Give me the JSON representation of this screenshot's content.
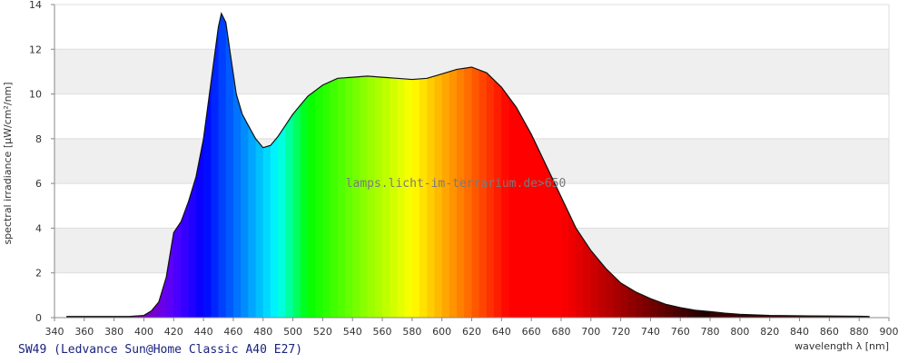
{
  "chart_data": {
    "type": "area",
    "title": "SW49 (Ledvance Sun@Home Classic A40 E27)",
    "xlabel": "wavelength λ [nm]",
    "ylabel": "spectral irradiance [µW/cm²/nm]",
    "watermark": "lamps.licht-im-terrarium.de>650",
    "xlim": [
      340,
      900
    ],
    "ylim": [
      0,
      14
    ],
    "x_ticks": [
      340,
      360,
      380,
      400,
      420,
      440,
      460,
      480,
      500,
      520,
      540,
      560,
      580,
      600,
      620,
      640,
      660,
      680,
      700,
      720,
      740,
      760,
      780,
      800,
      820,
      840,
      860,
      880,
      900
    ],
    "y_ticks": [
      0,
      2,
      4,
      6,
      8,
      10,
      12,
      14
    ],
    "grid": "horizontal alternating bands",
    "fill": "wavelength spectrum colors",
    "series": [
      {
        "x": [
          348,
          390,
          400,
          405,
          410,
          415,
          420,
          425,
          430,
          435,
          440,
          445,
          450,
          452,
          455,
          458,
          462,
          466,
          470,
          475,
          480,
          485,
          490,
          495,
          500,
          510,
          520,
          530,
          540,
          550,
          560,
          570,
          580,
          590,
          600,
          610,
          620,
          630,
          640,
          650,
          660,
          670,
          680,
          690,
          700,
          710,
          720,
          730,
          740,
          750,
          760,
          770,
          780,
          790,
          800,
          820,
          840,
          860,
          880,
          887
        ],
        "y": [
          0.05,
          0.05,
          0.1,
          0.3,
          0.7,
          1.8,
          3.8,
          4.3,
          5.2,
          6.3,
          8.0,
          10.5,
          13.0,
          13.6,
          13.2,
          11.8,
          10.0,
          9.1,
          8.6,
          8.0,
          7.6,
          7.7,
          8.1,
          8.6,
          9.1,
          9.9,
          10.4,
          10.7,
          10.75,
          10.8,
          10.75,
          10.7,
          10.65,
          10.7,
          10.9,
          11.1,
          11.2,
          10.95,
          10.3,
          9.4,
          8.2,
          6.8,
          5.4,
          4.0,
          3.0,
          2.2,
          1.55,
          1.15,
          0.85,
          0.6,
          0.45,
          0.33,
          0.27,
          0.2,
          0.15,
          0.1,
          0.08,
          0.07,
          0.06,
          0.05
        ]
      }
    ]
  }
}
